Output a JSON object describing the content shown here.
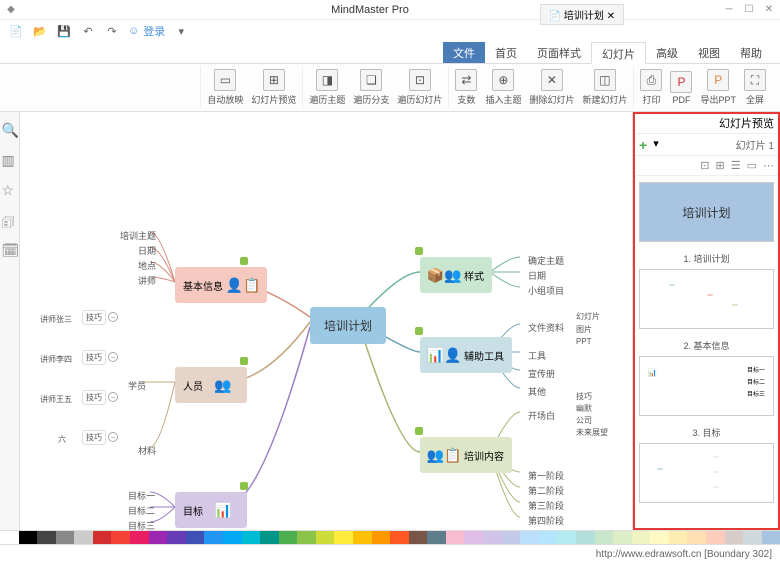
{
  "app": {
    "title": "MindMaster Pro",
    "login_label": "登录"
  },
  "tabs": {
    "items": [
      "文件",
      "首页",
      "页面样式",
      "幻灯片",
      "高级",
      "视图",
      "帮助"
    ],
    "active_index": 3
  },
  "ribbon": {
    "groups": [
      {
        "items": [
          {
            "label": "幻灯片预览",
            "icon": "⊞"
          },
          {
            "label": "自动放映",
            "icon": "▭"
          }
        ]
      },
      {
        "items": [
          {
            "label": "遍历幻灯片",
            "icon": "⊡"
          },
          {
            "label": "遍历分支",
            "icon": "❏"
          },
          {
            "label": "遍历主题",
            "icon": "◨"
          }
        ]
      },
      {
        "items": [
          {
            "label": "新建幻灯片",
            "icon": "◫"
          },
          {
            "label": "删除幻灯片",
            "icon": "✕"
          },
          {
            "label": "插入主题",
            "icon": "⊕"
          },
          {
            "label": "支数",
            "icon": "⇄"
          }
        ]
      },
      {
        "items": [
          {
            "label": "全屏",
            "icon": "⛶"
          },
          {
            "label": "导出PPT",
            "icon": "P"
          },
          {
            "label": "PDF",
            "icon": "P"
          },
          {
            "label": "打印",
            "icon": "⎙"
          }
        ]
      }
    ]
  },
  "document_tab": "培训计划",
  "mindmap": {
    "center": "培训计划",
    "right_branches": [
      {
        "label": "样式",
        "color": "#c8e6d0",
        "children": [
          "确定主题",
          "日期",
          "小组项目"
        ]
      },
      {
        "label": "辅助工具",
        "color": "#c8dfe6",
        "children": [
          "工具",
          "宣传册",
          "其他"
        ],
        "sub": {
          "parent": "文件资料",
          "items": [
            "幻灯片",
            "图片",
            "PPT"
          ]
        }
      },
      {
        "label": "培训内容",
        "color": "#dde6c8",
        "summary": "开场白",
        "summary_items": [
          "技巧",
          "幽默",
          "公司",
          "未来展望"
        ],
        "children": [
          "第一阶段",
          "第二阶段",
          "第三阶段",
          "第四阶段"
        ]
      }
    ],
    "left_branches": [
      {
        "label": "基本信息",
        "color": "#f5c9c0",
        "children": [
          "培训主题",
          "日期",
          "地点",
          "讲师"
        ]
      },
      {
        "label": "人员",
        "color": "#e6d4c8",
        "group": "学员",
        "students": [
          {
            "label": "技巧",
            "detail": "讲师张三"
          },
          {
            "label": "技巧",
            "detail": "讲师李四"
          },
          {
            "label": "技巧",
            "detail": "讲师王五"
          },
          {
            "label": "技巧",
            "detail": "六"
          }
        ],
        "extra": "材料"
      },
      {
        "label": "目标",
        "color": "#d4c8e6",
        "children": [
          "目标一",
          "目标二",
          "目标三"
        ]
      }
    ]
  },
  "sidepanel": {
    "title": "幻灯片预览",
    "counter": "幻灯片 1",
    "slides": [
      {
        "title": "培训计划",
        "caption": ""
      },
      {
        "title": "",
        "caption": "1. 培训计划"
      },
      {
        "title": "",
        "caption": "2. 基本信息"
      },
      {
        "title": "",
        "caption": "3. 目标"
      }
    ]
  },
  "statusbar": {
    "text": "http://www.edrawsoft.cn [Boundary 302]"
  },
  "colors": [
    "#ffffff",
    "#000000",
    "#444444",
    "#888888",
    "#cccccc",
    "#d32f2f",
    "#f44336",
    "#e91e63",
    "#9c27b0",
    "#673ab7",
    "#3f51b5",
    "#2196f3",
    "#03a9f4",
    "#00bcd4",
    "#009688",
    "#4caf50",
    "#8bc34a",
    "#cddc39",
    "#ffeb3b",
    "#ffc107",
    "#ff9800",
    "#ff5722",
    "#795548",
    "#607d8b",
    "#f8bbd0",
    "#e1bee7",
    "#d1c4e9",
    "#c5cae9",
    "#bbdefb",
    "#b3e5fc",
    "#b2ebf2",
    "#b2dfdb",
    "#c8e6c9",
    "#dcedc8",
    "#f0f4c3",
    "#fff9c4",
    "#ffecb3",
    "#ffe0b2",
    "#ffccbc",
    "#d7ccc8",
    "#cfd8dc",
    "#a8c4e0"
  ]
}
